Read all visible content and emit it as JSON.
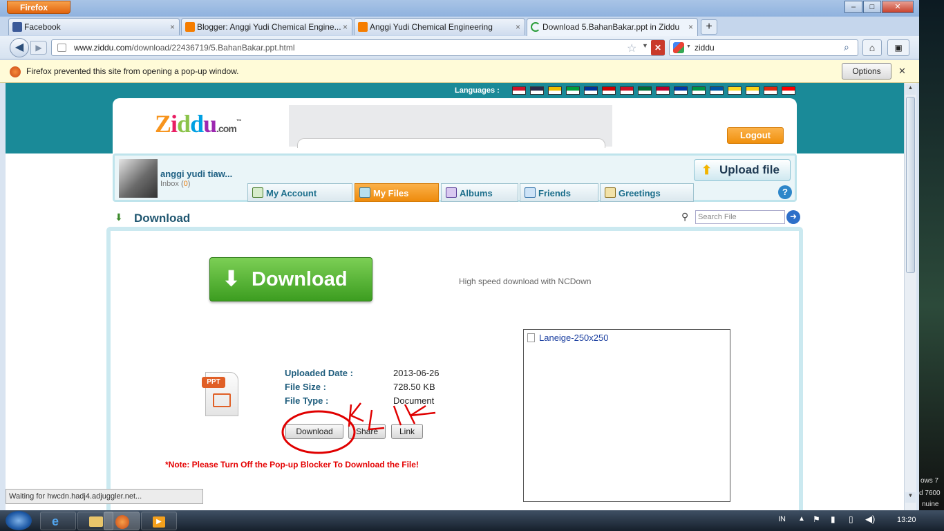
{
  "browser": {
    "menu_label": "Firefox",
    "window_controls": [
      "–",
      "□",
      "✕"
    ],
    "tabs": [
      {
        "label": "Facebook",
        "icon": "facebook-icon",
        "color": "#3b5998"
      },
      {
        "label": "Blogger: Anggi Yudi Chemical Engine...",
        "icon": "blogger-icon",
        "color": "#f57d00"
      },
      {
        "label": "Anggi Yudi Chemical Engineering",
        "icon": "blogger-icon",
        "color": "#f57d00"
      },
      {
        "label": "Download 5.BahanBakar.ppt in Ziddu",
        "icon": "loading-icon",
        "color": "#2a9d3a"
      }
    ],
    "new_tab": "+",
    "url_prefix": "www.ziddu.com",
    "url_rest": "/download/22436719/5.BahanBakar.ppt.html",
    "search_value": "ziddu",
    "popup_message": "Firefox prevented this site from opening a pop-up window.",
    "popup_options": "Options",
    "status": "Waiting for hwcdn.hadj4.adjuggler.net..."
  },
  "site": {
    "languages_label": "Languages :",
    "flags": [
      "#cf142b",
      "#2d2a4a",
      "#f1bf00",
      "#009c3b",
      "#003399",
      "#cc0001",
      "#ce1126",
      "#006c35",
      "#bc002d",
      "#0039a6",
      "#009246",
      "#0055a4",
      "#fdda24",
      "#fcd116",
      "#de2910",
      "#fe0000"
    ],
    "logo": {
      "z": "Z",
      "i": "i",
      "d1": "d",
      "d2": "d",
      "u": "u",
      "com": ".com",
      "tm": "™"
    },
    "logout": "Logout",
    "user": {
      "name": "anggi yudi tiaw...",
      "inbox": "Inbox",
      "inbox_open": "(",
      "inbox_count": "0",
      "inbox_close": ")"
    },
    "upload_label": "Upload file",
    "help": "?",
    "nav": [
      {
        "label": "My Account"
      },
      {
        "label": "My Files"
      },
      {
        "label": "Albums"
      },
      {
        "label": "Friends"
      },
      {
        "label": "Greetings"
      }
    ],
    "section_title": "Download",
    "search_placeholder": "Search File",
    "big_download": "Download",
    "ncdown": "High speed download with NCDown",
    "ppt_badge": "PPT",
    "info": [
      {
        "label": "Uploaded Date :",
        "value": "2013-06-26"
      },
      {
        "label": "File Size :",
        "value": "728.50 KB"
      },
      {
        "label": "File Type :",
        "value": "Document"
      }
    ],
    "buttons": {
      "download": "Download",
      "share": "Share",
      "link": "Link"
    },
    "note": "*Note: Please Turn Off the Pop-up Blocker To Download the File!",
    "ad_label": "Laneige-250x250"
  },
  "annotation": {
    "text": "KLIK",
    "color": "#e00000"
  },
  "taskbar": {
    "lang": "IN",
    "clock": "13:20",
    "win_lines": [
      "ows 7",
      "d 7600",
      "nuine"
    ]
  }
}
